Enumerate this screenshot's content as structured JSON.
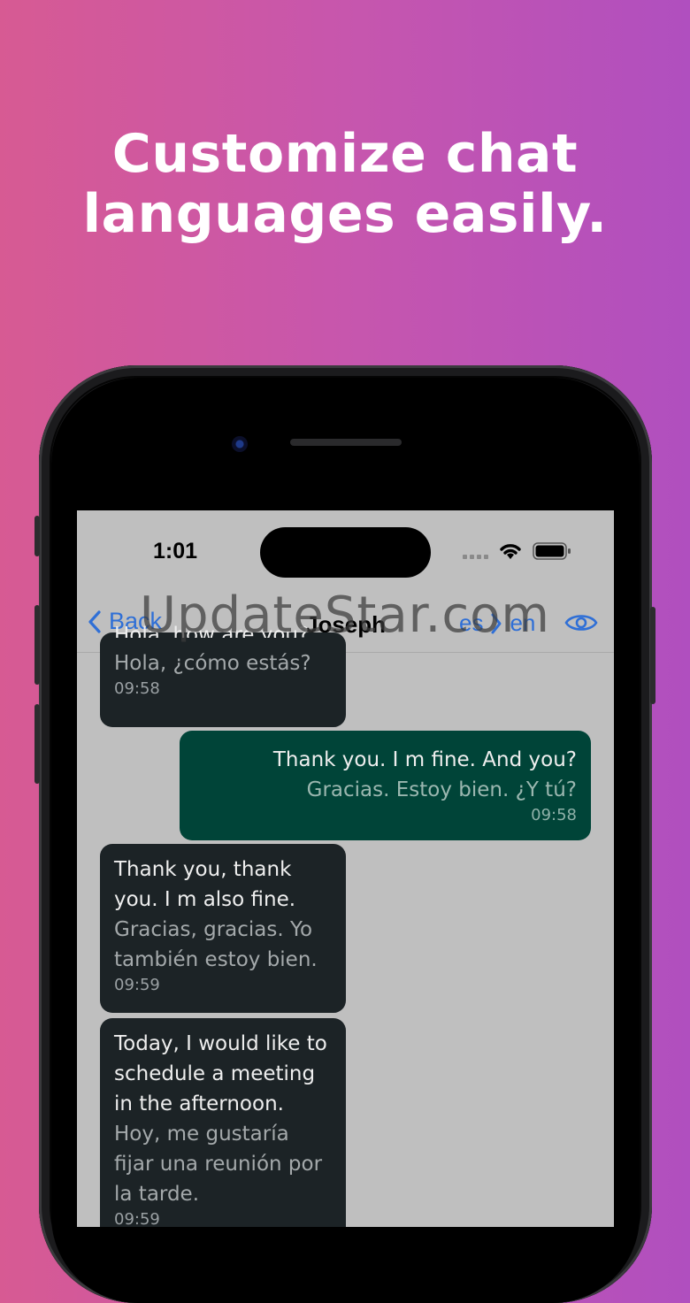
{
  "headline": {
    "line1": "Customize chat",
    "line2": "languages easily."
  },
  "status_bar": {
    "time": "1:01"
  },
  "nav": {
    "back_label": "Back",
    "title": "Joseph",
    "source_lang": "es",
    "target_lang": "en",
    "accent_color": "#2f6fd6"
  },
  "messages": [
    {
      "direction": "incoming",
      "original": "Hola, how are you?",
      "translation": "Hola, ¿cómo estás?",
      "time": "09:58"
    },
    {
      "direction": "outgoing",
      "original": "Thank you. I m fine. And you?",
      "translation": "Gracias. Estoy bien. ¿Y tú?",
      "time": "09:58"
    },
    {
      "direction": "incoming",
      "original": "Thank you, thank you. I m also fine.",
      "translation": "Gracias, gracias. Yo también estoy bien.",
      "time": "09:59"
    },
    {
      "direction": "incoming",
      "original": "Today, I would like to schedule a meeting in the afternoon.",
      "translation": "Hoy, me gustaría fijar una reunión por la tarde.",
      "time": "09:59"
    }
  ],
  "watermark": "UpdateStar.com",
  "colors": {
    "incoming_bubble": "#1c2326",
    "outgoing_bubble": "#004438",
    "chat_background": "#bfbfbf"
  }
}
